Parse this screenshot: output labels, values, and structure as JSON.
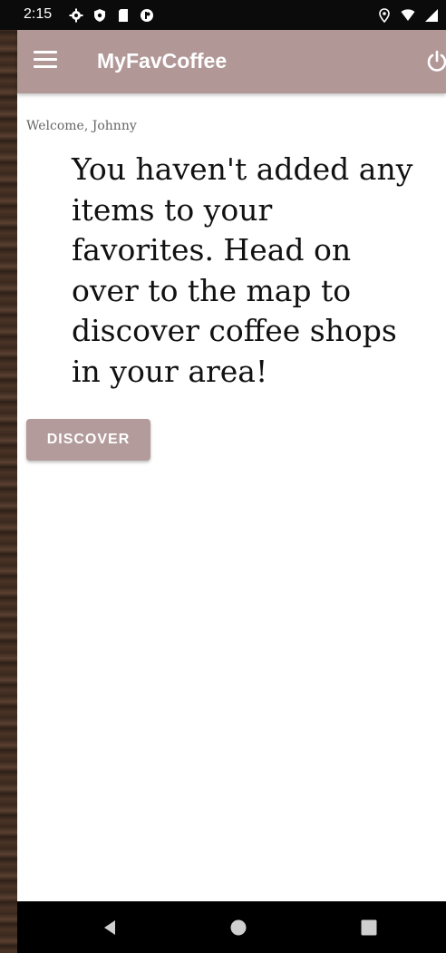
{
  "status_bar": {
    "time": "2:15",
    "left_icons": [
      "settings-icon",
      "shield-icon",
      "sd-card-icon",
      "app-notification-icon"
    ],
    "right_icons": [
      "location-icon",
      "wifi-icon",
      "signal-icon"
    ]
  },
  "app_bar": {
    "title": "MyFavCoffee",
    "menu_icon": "menu-icon",
    "power_icon": "power-icon",
    "color": "#b29797"
  },
  "main": {
    "welcome_text": "Welcome, Johnny",
    "empty_message": "You haven't added any items to your favorites. Head on over to the map to discover coffee shops in your area!",
    "discover_label": "DISCOVER"
  },
  "nav_bar": {
    "icons": [
      "back-icon",
      "home-icon",
      "recents-icon"
    ]
  }
}
